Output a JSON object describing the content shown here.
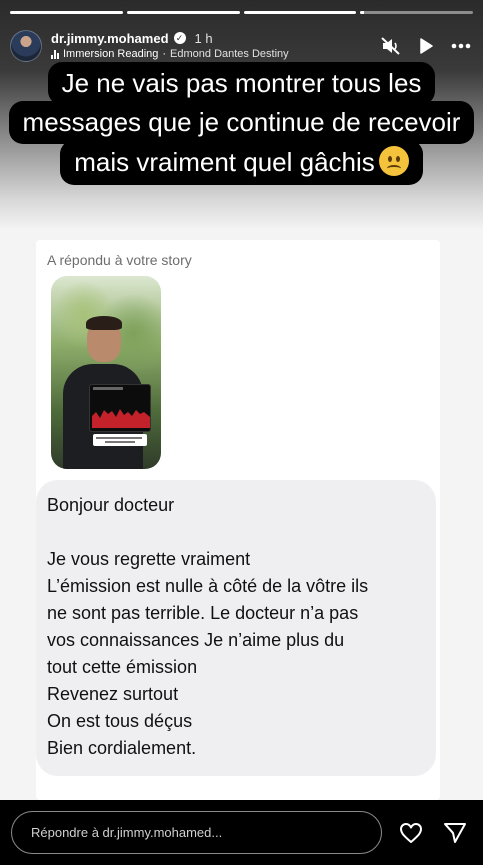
{
  "progress": [
    1,
    1,
    1,
    0.03
  ],
  "header": {
    "username": "dr.jimmy.mohamed",
    "time": "1 h",
    "music_title": "Immersion Reading",
    "music_separator": "·",
    "music_artist": "Edmond Dantes Destiny",
    "icons": [
      "muted-speaker-icon",
      "play-icon",
      "more-icon"
    ]
  },
  "caption": {
    "lines": [
      "Je ne vais pas montrer tous les",
      "messages que je continue de recevoir",
      "mais vraiment quel gâchis"
    ],
    "emoji": "slightly-frowning-face-emoji"
  },
  "dm": {
    "reply_label": "A répondu à votre story",
    "message": {
      "greeting": "Bonjour docteur",
      "lines": [
        "Je vous regrette vraiment",
        "L’émission est nulle à côté de la vôtre   ils",
        "ne sont pas terrible. Le docteur n’a pas",
        "vos connaissances   Je  n’aime plus du",
        "tout cette émission",
        "Revenez surtout",
        "On est tous déçus",
        "Bien cordialement."
      ]
    }
  },
  "reply_bar": {
    "placeholder": "Répondre à dr.jimmy.mohamed...",
    "icons": [
      "heart-icon",
      "send-icon"
    ]
  },
  "colors": {
    "caption_bg": "#000000",
    "bubble_bg": "#efeff1",
    "card_bg": "#ffffff",
    "label_gray": "#6d6d6d"
  }
}
